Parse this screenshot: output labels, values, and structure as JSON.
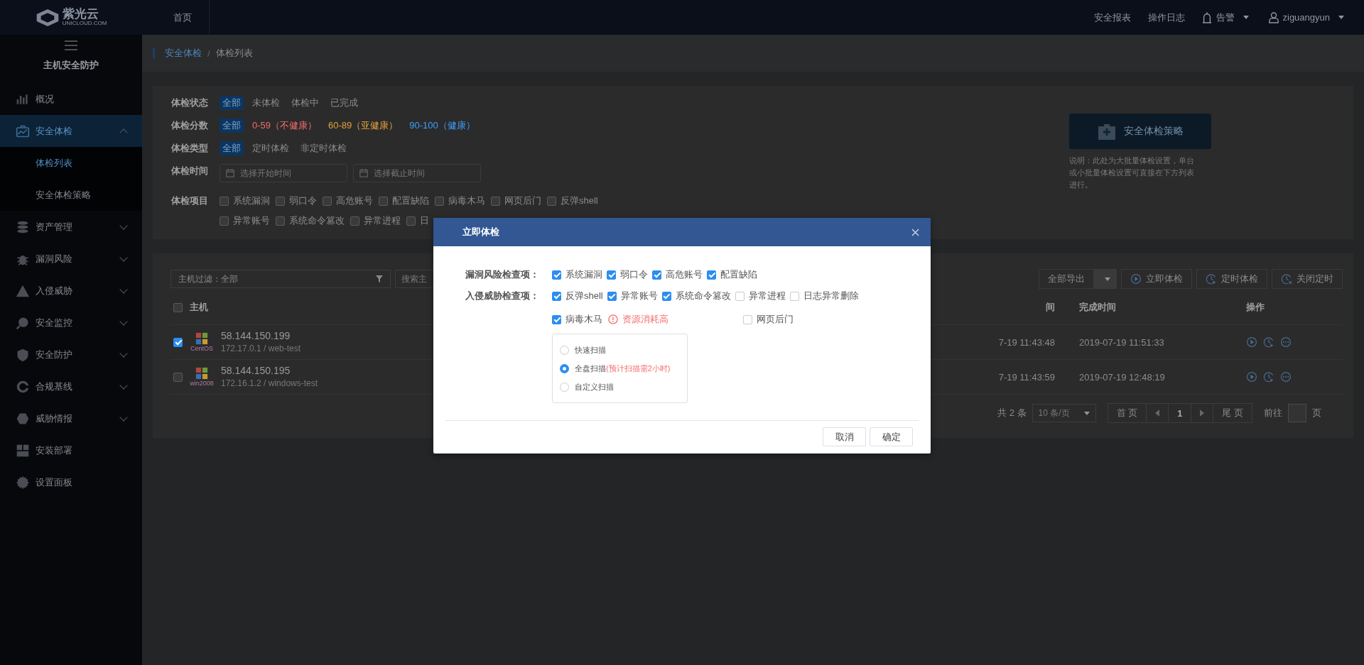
{
  "topbar": {
    "logo": "紫光云",
    "logo_sub": "UNICLOUD.COM",
    "home": "首页",
    "links": [
      "安全报表",
      "操作日志"
    ],
    "alarm": "告警",
    "user": "ziguangyun"
  },
  "sidebar": {
    "title": "主机安全防护",
    "items": [
      {
        "label": "概况",
        "kind": "link",
        "selected": false
      },
      {
        "label": "安全体检",
        "kind": "group",
        "selected": true,
        "expanded": true,
        "children": [
          {
            "label": "体检列表",
            "selected": true
          },
          {
            "label": "安全体检策略",
            "selected": false
          }
        ]
      },
      {
        "label": "资产管理",
        "kind": "group",
        "selected": false,
        "expanded": false
      },
      {
        "label": "漏洞风险",
        "kind": "group",
        "selected": false,
        "expanded": false
      },
      {
        "label": "入侵威胁",
        "kind": "group",
        "selected": false,
        "expanded": false
      },
      {
        "label": "安全监控",
        "kind": "group",
        "selected": false,
        "expanded": false
      },
      {
        "label": "安全防护",
        "kind": "group",
        "selected": false,
        "expanded": false
      },
      {
        "label": "合规基线",
        "kind": "group",
        "selected": false,
        "expanded": false
      },
      {
        "label": "威胁情报",
        "kind": "group",
        "selected": false,
        "expanded": false
      },
      {
        "label": "安装部署",
        "kind": "link",
        "selected": false
      },
      {
        "label": "设置面板",
        "kind": "link",
        "selected": false
      }
    ]
  },
  "breadcrumb": [
    "安全体检",
    "体检列表"
  ],
  "breadcrumb_separator": "/",
  "filters": [
    {
      "label": "体检状态",
      "kind": "options",
      "options": [
        {
          "label": "全部",
          "selected": true
        },
        {
          "label": "未体检",
          "selected": false
        },
        {
          "label": "体检中",
          "selected": false
        },
        {
          "label": "已完成",
          "selected": false
        }
      ]
    },
    {
      "label": "体检分数",
      "kind": "options",
      "options": [
        {
          "label": "全部",
          "selected": true
        },
        {
          "label": "0-59（不健康）",
          "selected": false,
          "color": "#f56c6c"
        },
        {
          "label": "60-89（亚健康）",
          "selected": false,
          "color": "#e6a23c"
        },
        {
          "label": "90-100（健康）",
          "selected": false,
          "color": "#409eff"
        }
      ]
    },
    {
      "label": "体检类型",
      "kind": "options",
      "options": [
        {
          "label": "全部",
          "selected": true
        },
        {
          "label": "定时体检",
          "selected": false
        },
        {
          "label": "非定时体检",
          "selected": false
        }
      ]
    },
    {
      "label": "体检时间",
      "kind": "dates",
      "placeholders": [
        "选择开始时间",
        "选择截止时间"
      ]
    },
    {
      "label": "体检项目",
      "kind": "checks",
      "rows": [
        [
          {
            "label": "系统漏洞",
            "checked": false
          },
          {
            "label": "弱口令",
            "checked": false
          },
          {
            "label": "高危账号",
            "checked": false
          },
          {
            "label": "配置缺陷",
            "checked": false
          },
          {
            "label": "病毒木马",
            "checked": false
          },
          {
            "label": "网页后门",
            "checked": false
          },
          {
            "label": "反弹shell",
            "checked": false
          }
        ],
        [
          {
            "label": "异常账号",
            "checked": false
          },
          {
            "label": "系统命令篡改",
            "checked": false
          },
          {
            "label": "异常进程",
            "checked": false
          },
          {
            "label": "日",
            "checked": false
          }
        ]
      ]
    }
  ],
  "strategy": {
    "button": "安全体检策略",
    "note": "说明：此处为大批量体检设置，单台或小批量体检设置可直接在下方列表进行。"
  },
  "table": {
    "host_filter": "主机过滤：全部",
    "search_placeholder": "搜索主",
    "export": "全部导出",
    "actions": [
      "立即体检",
      "定时体检",
      "关闭定时"
    ],
    "header_checked": false,
    "columns": [
      "主机",
      "间",
      "完成时间",
      "操作"
    ],
    "rows": [
      {
        "checked": true,
        "os": "CentOS",
        "ip": "58.144.150.199",
        "detail": "172.17.0.1 / web-test",
        "column_2": "7-19 11:43:48",
        "finished": "2019-07-19 11:51:33"
      },
      {
        "checked": false,
        "os": "win2008",
        "ip": "58.144.150.195",
        "detail": "172.16.1.2 / windows-test",
        "column_2": "7-19 11:43:59",
        "finished": "2019-07-19 12:48:19"
      }
    ]
  },
  "pagination": {
    "total": "共 2 条",
    "page_size": "10 条/页",
    "first": "首 页",
    "pages": [
      {
        "label": "1",
        "selected": true
      }
    ],
    "last": "尾 页",
    "goto": "前往",
    "goto_unit": "页"
  },
  "modal": {
    "title": "立即体检",
    "groups": [
      {
        "label": "漏洞风险检查项：",
        "items": [
          {
            "label": "系统漏洞",
            "checked": true
          },
          {
            "label": "弱口令",
            "checked": true
          },
          {
            "label": "高危账号",
            "checked": true
          },
          {
            "label": "配置缺陷",
            "checked": true
          }
        ]
      },
      {
        "label": "入侵威胁检查项：",
        "items": [
          {
            "label": "反弹shell",
            "checked": true
          },
          {
            "label": "异常账号",
            "checked": true
          },
          {
            "label": "系统命令篡改",
            "checked": true
          },
          {
            "label": "异常进程",
            "checked": false
          },
          {
            "label": "日志异常删除",
            "checked": false
          }
        ],
        "extra": [
          {
            "label": "病毒木马",
            "checked": true,
            "warning": "资源消耗高"
          },
          {
            "label": "网页后门",
            "checked": false
          }
        ]
      }
    ],
    "scan_modes": [
      {
        "label": "快速扫描",
        "selected": false
      },
      {
        "label": "全盘扫描",
        "selected": true,
        "note": "(预计扫描需2小时)"
      },
      {
        "label": "自定义扫描",
        "selected": false
      }
    ],
    "buttons": [
      "取消",
      "确定"
    ]
  }
}
